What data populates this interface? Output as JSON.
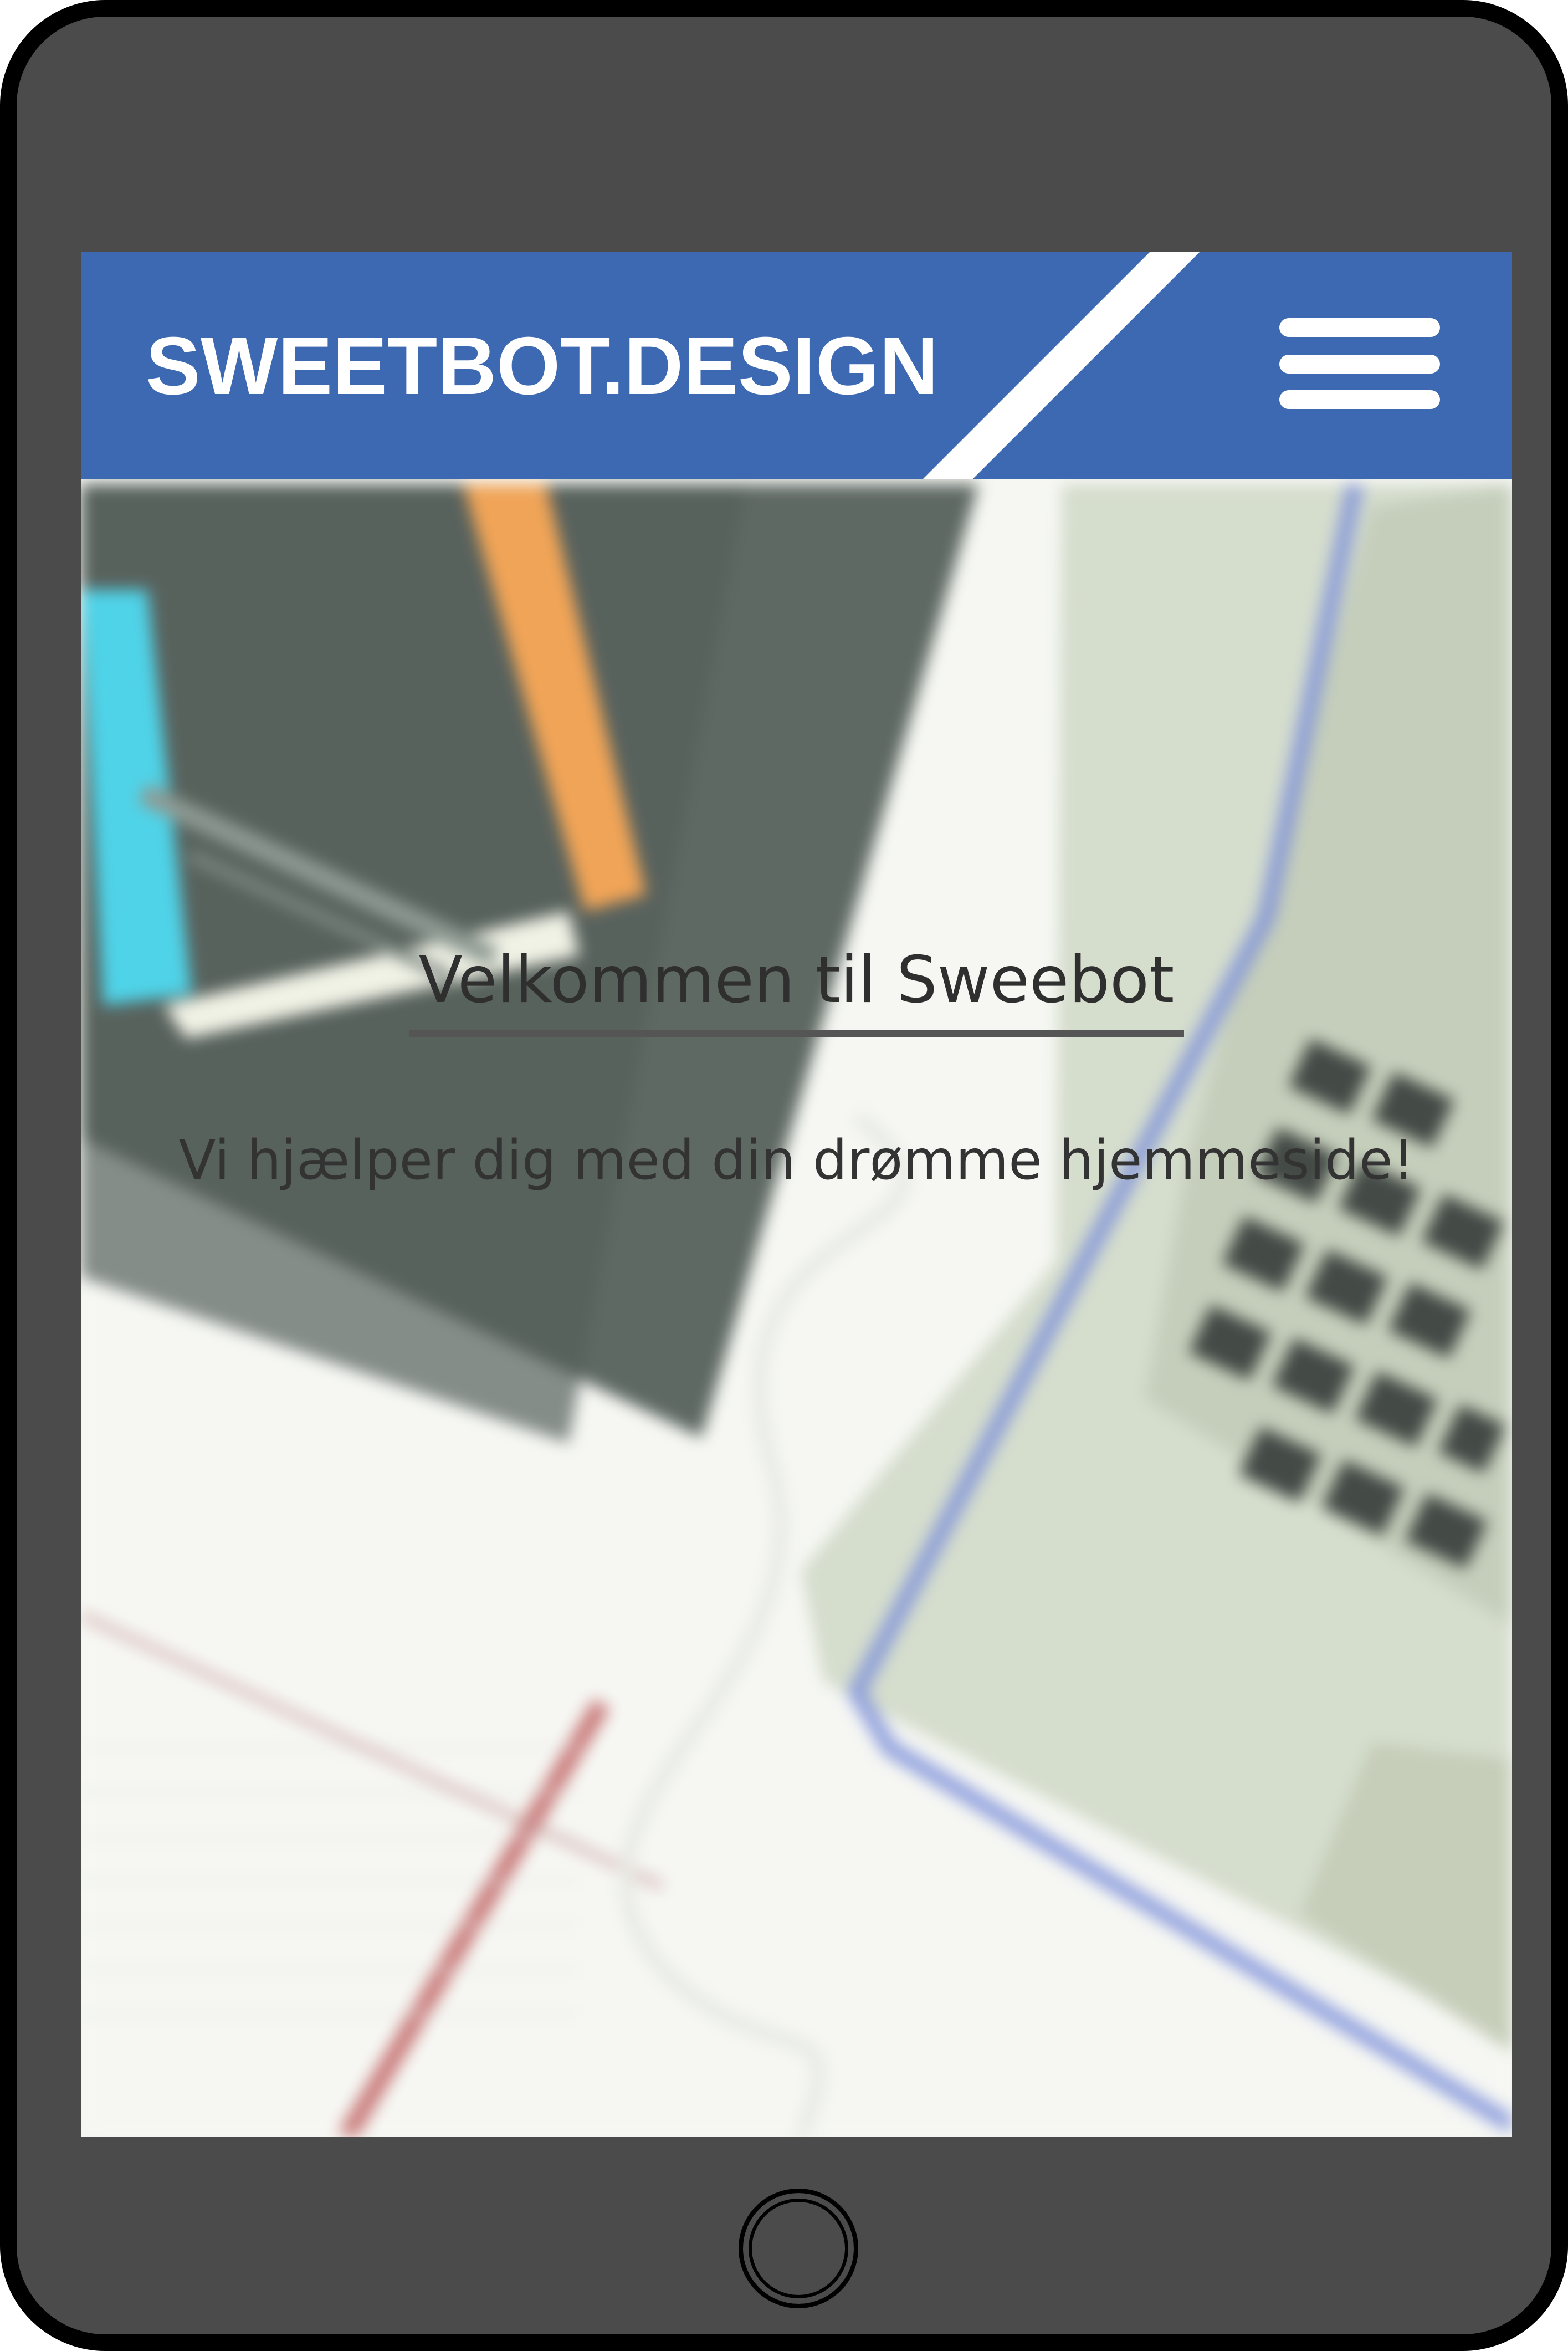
{
  "app": {
    "brand": "SWEETBOT.DESIGN",
    "menu_icon": "hamburger-menu-icon"
  },
  "hero": {
    "title": "Velkommen til Sweebot",
    "subtitle": "Vi hjælper dig med din drømme hjemmeside!"
  },
  "device": {
    "home_button_icon": "home-button-circle"
  },
  "colors": {
    "nav_blue": "#3d69b2",
    "device_frame": "#4b4b4b",
    "device_outline": "#000000",
    "text_dark": "#2f2f2f"
  }
}
